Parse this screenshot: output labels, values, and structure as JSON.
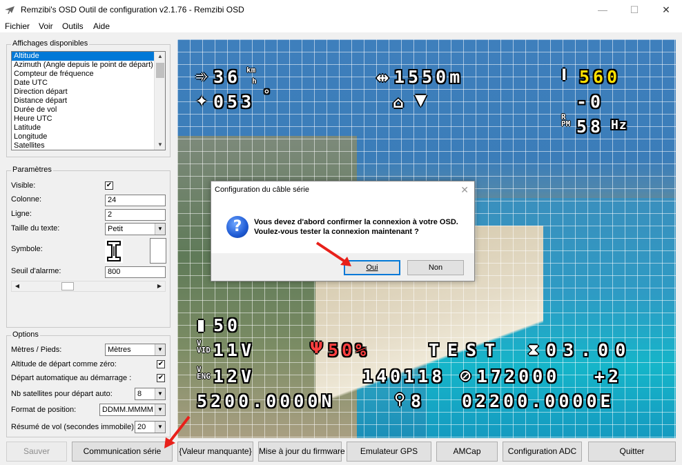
{
  "window": {
    "title": "Remzibi's OSD Outil de configuration v2.1.76 - Remzibi OSD",
    "minimize": "—",
    "maximize": "☐",
    "close": "✕"
  },
  "menu": [
    "Fichier",
    "Voir",
    "Outils",
    "Aide"
  ],
  "affichages": {
    "title": "Affichages disponibles",
    "items": [
      "Altitude",
      "Azimuth (Angle depuis le point de départ)",
      "Compteur de fréquence",
      "Date UTC",
      "Direction départ",
      "Distance départ",
      "Durée de vol",
      "Heure UTC",
      "Latitude",
      "Longitude",
      "Satellites"
    ],
    "selected_index": 0
  },
  "parametres": {
    "title": "Paramètres",
    "visible_label": "Visible:",
    "visible_checked": true,
    "colonne_label": "Colonne:",
    "colonne_value": "24",
    "ligne_label": "Ligne:",
    "ligne_value": "2",
    "taille_label": "Taille du texte:",
    "taille_value": "Petit",
    "symbole_label": "Symbole:",
    "seuil_label": "Seuil d'alarme:",
    "seuil_value": "800"
  },
  "options": {
    "title": "Options",
    "metres_label": "Mètres / Pieds:",
    "metres_value": "Mètres",
    "altitude_zero_label": "Altitude de départ comme zéro:",
    "altitude_zero_checked": true,
    "depart_auto_label": "Départ automatique au démarrage :",
    "depart_auto_checked": true,
    "nb_sat_label": "Nb satellites pour départ auto:",
    "nb_sat_value": "8",
    "format_label": "Format de position:",
    "format_value": "DDMM.MMMM",
    "resume_label": "Résumé de vol (secondes immobile):",
    "resume_value": "20"
  },
  "osd": {
    "speed": "36",
    "dist_home": "1550m",
    "altitude": "560",
    "heading": "053",
    "vario": "-0",
    "rpm": "58",
    "rpm_unit": "Hz",
    "speed_unit_top": "km",
    "speed_unit_bottom": "h",
    "battery": "50",
    "vid_voltage": "11V",
    "signal": "50%",
    "test": "TEST",
    "timer": "03.00",
    "eng_voltage": "12V",
    "date_time": "140118",
    "time": "172000",
    "tz": "+2",
    "latitude": "5200.0000N",
    "satellites": "8",
    "longitude": "02200.0000E",
    "degree": "°"
  },
  "dialog": {
    "title": "Configuration du câble série",
    "line1": "Vous devez d'abord confirmer la connexion à votre OSD.",
    "line2": "Voulez-vous tester la connexion maintenant ?",
    "yes": "Oui",
    "no": "Non",
    "close": "✕",
    "icon": "?"
  },
  "buttons": {
    "sauver": "Sauver",
    "communication": "Communication série",
    "valeur": "{Valeur manquante}",
    "firmware": "Mise à jour du firmware",
    "gps": "Emulateur GPS",
    "amcap": "AMCap",
    "adc": "Configuration ADC",
    "quitter": "Quitter"
  },
  "colors": {
    "selection": "#0078d7",
    "arrow": "#e8201a",
    "osd_yellow": "#ffe000",
    "osd_red": "#ff4040"
  }
}
